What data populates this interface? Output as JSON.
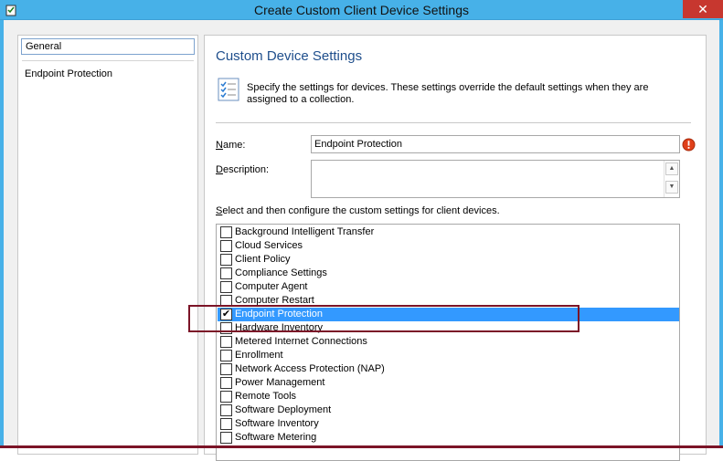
{
  "window": {
    "title": "Create Custom Client Device Settings",
    "close_glyph": "✕",
    "accent_color": "#47b1e8"
  },
  "nav": {
    "items": [
      {
        "label": "General",
        "selected": true
      },
      {
        "label": "Endpoint Protection",
        "selected": false
      }
    ]
  },
  "content": {
    "title": "Custom Device Settings",
    "description": "Specify the settings for devices. These settings override the default settings when they are assigned to a collection.",
    "name_label_first": "N",
    "name_label_rest": "ame:",
    "name_value": "Endpoint Protection",
    "description_label_first": "D",
    "description_label_rest": "escription:",
    "description_value": "",
    "list_caption_first": "S",
    "list_caption_rest": "elect and then configure the custom settings for client devices."
  },
  "settings": [
    {
      "label": "Background Intelligent Transfer",
      "checked": false
    },
    {
      "label": "Cloud Services",
      "checked": false
    },
    {
      "label": "Client Policy",
      "checked": false
    },
    {
      "label": "Compliance Settings",
      "checked": false
    },
    {
      "label": "Computer Agent",
      "checked": false
    },
    {
      "label": "Computer Restart",
      "checked": false
    },
    {
      "label": "Endpoint Protection",
      "checked": true
    },
    {
      "label": "Hardware Inventory",
      "checked": false
    },
    {
      "label": "Metered Internet Connections",
      "checked": false
    },
    {
      "label": "Enrollment",
      "checked": false
    },
    {
      "label": "Network Access Protection (NAP)",
      "checked": false
    },
    {
      "label": "Power Management",
      "checked": false
    },
    {
      "label": "Remote Tools",
      "checked": false
    },
    {
      "label": "Software Deployment",
      "checked": false
    },
    {
      "label": "Software Inventory",
      "checked": false
    },
    {
      "label": "Software Metering",
      "checked": false
    }
  ],
  "selected_setting": "Endpoint Protection",
  "checkmark_glyph": "✔",
  "colors": {
    "selection": "#3399ff",
    "annotation": "#7b1427",
    "header_text": "#1e4e8c"
  }
}
